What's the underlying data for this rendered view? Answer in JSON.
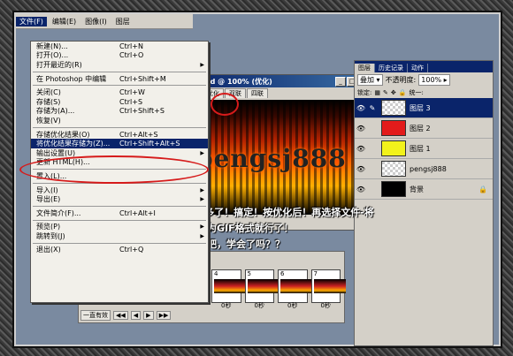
{
  "menubar": {
    "items": [
      "文件(F)",
      "编辑(E)",
      "图像(I)",
      "图层"
    ]
  },
  "image_window": {
    "title": "11.psd @ 100% (优化)",
    "tabs": [
      "优化",
      "双联",
      "四联"
    ],
    "canvas_text": "pengsj888"
  },
  "file_menu": {
    "items": [
      {
        "label": "新建(N)...",
        "shortcut": "Ctrl+N"
      },
      {
        "label": "打开(O)...",
        "shortcut": "Ctrl+O"
      },
      {
        "label": "打开最近的(R)",
        "shortcut": "",
        "submenu": true
      },
      {
        "sep": true
      },
      {
        "label": "在 Photoshop 中编辑",
        "shortcut": "Ctrl+Shift+M"
      },
      {
        "sep": true
      },
      {
        "label": "关闭(C)",
        "shortcut": "Ctrl+W"
      },
      {
        "label": "存储(S)",
        "shortcut": "Ctrl+S"
      },
      {
        "label": "存储为(A)...",
        "shortcut": "Ctrl+Shift+S"
      },
      {
        "label": "恢复(V)",
        "shortcut": ""
      },
      {
        "sep": true
      },
      {
        "label": "存储优化结果(O)",
        "shortcut": "Ctrl+Alt+S"
      },
      {
        "label": "将优化结果存储为(Z)...",
        "shortcut": "Ctrl+Shift+Alt+S",
        "highlight": true
      },
      {
        "label": "输出设置(U)",
        "shortcut": "",
        "submenu": true
      },
      {
        "label": "更新 HTML(H)...",
        "shortcut": ""
      },
      {
        "sep": true
      },
      {
        "label": "置入(L)...",
        "shortcut": ""
      },
      {
        "sep": true
      },
      {
        "label": "导入(I)",
        "shortcut": "",
        "submenu": true
      },
      {
        "label": "导出(E)",
        "shortcut": "",
        "submenu": true
      },
      {
        "sep": true
      },
      {
        "label": "文件简介(F)...",
        "shortcut": "Ctrl+Alt+I"
      },
      {
        "sep": true
      },
      {
        "label": "预览(P)",
        "shortcut": "",
        "submenu": true
      },
      {
        "label": "跳转到(J)",
        "shortcut": "",
        "submenu": true
      },
      {
        "sep": true
      },
      {
        "label": "退出(X)",
        "shortcut": "Ctrl+Q"
      }
    ]
  },
  "layers_panel": {
    "tabs": [
      "图层",
      "历史记录",
      "动作"
    ],
    "blend_mode": "叠加",
    "opacity_label": "不透明度:",
    "opacity": "100%",
    "lock_label": "锁定:",
    "unify_label": "统一:",
    "layers": [
      {
        "name": "图层 3",
        "thumb_color": "checker",
        "selected": true
      },
      {
        "name": "图层 2",
        "thumb_color": "#e31b1b",
        "selected": false
      },
      {
        "name": "图层 1",
        "thumb_color": "#f2f21b",
        "selected": false
      },
      {
        "name": "pengsj888",
        "thumb_color": "checker",
        "selected": false
      },
      {
        "name": "背景",
        "thumb_color": "#000000",
        "selected": false,
        "locked": true
      }
    ]
  },
  "animation": {
    "frames": [
      {
        "num": "4",
        "duration": "0秒"
      },
      {
        "num": "5",
        "duration": "0秒"
      },
      {
        "num": "6",
        "duration": "0秒"
      },
      {
        "num": "7",
        "duration": "0秒"
      }
    ],
    "first_frame_duration": "0秒",
    "loop": "一直有效"
  },
  "overlay_text": {
    "line1": "17. OK差不多了！搞定！按优化后！再选择文件-将",
    "line2": "优化结果存储为GIF格式就行了！",
    "line3": "呵呵够详细了吧，学会了吗？？"
  }
}
